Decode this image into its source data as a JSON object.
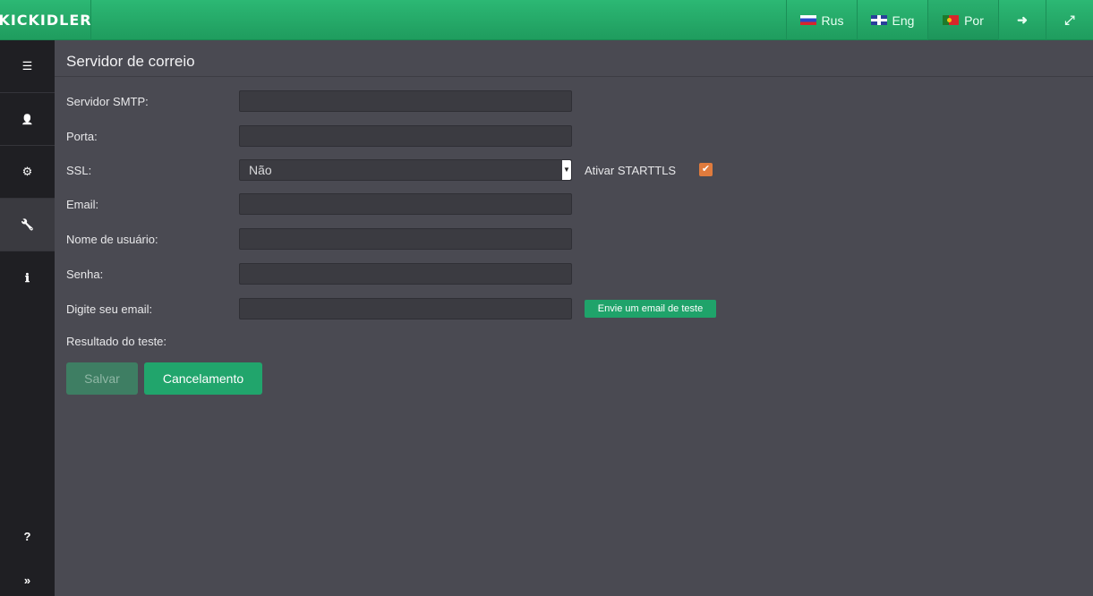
{
  "app": {
    "logo": "KICKIDLER"
  },
  "topbar": {
    "languages": [
      {
        "label": "Rus",
        "flag": "ru-flag-icon"
      },
      {
        "label": "Eng",
        "flag": "uk-flag-icon"
      },
      {
        "label": "Por",
        "flag": "pt-flag-icon"
      }
    ],
    "logout_icon": "➜",
    "fullscreen_icon": "⤢"
  },
  "sidebar": {
    "items": [
      {
        "icon": "☰",
        "name": "list-icon"
      },
      {
        "icon": "👤",
        "name": "user-icon"
      },
      {
        "icon": "⚙",
        "name": "gears-icon"
      },
      {
        "icon": "🔧",
        "name": "wrench-icon",
        "active": true
      },
      {
        "icon": "ℹ",
        "name": "info-icon"
      }
    ],
    "help": "?",
    "expand": "»"
  },
  "page": {
    "title": "Servidor de correio",
    "fields": {
      "smtp": {
        "label": "Servidor SMTP:",
        "value": ""
      },
      "port": {
        "label": "Porta:",
        "value": ""
      },
      "ssl": {
        "label": "SSL:",
        "value": "Não",
        "starttls_label": "Ativar STARTTLS",
        "starttls_checked": true
      },
      "email": {
        "label": "Email:",
        "value": ""
      },
      "username": {
        "label": "Nome de usuário:",
        "value": ""
      },
      "password": {
        "label": "Senha:",
        "value": ""
      },
      "test_email": {
        "label": "Digite seu email:",
        "value": "",
        "button": "Envie um email de teste"
      },
      "test_result": {
        "label": "Resultado do teste:"
      }
    },
    "buttons": {
      "save": "Salvar",
      "cancel": "Cancelamento"
    }
  },
  "colors": {
    "accent": "#21a56c",
    "checkbox": "#e07b3d",
    "background": "#4a4a52",
    "sidebar": "#1f1f23"
  }
}
